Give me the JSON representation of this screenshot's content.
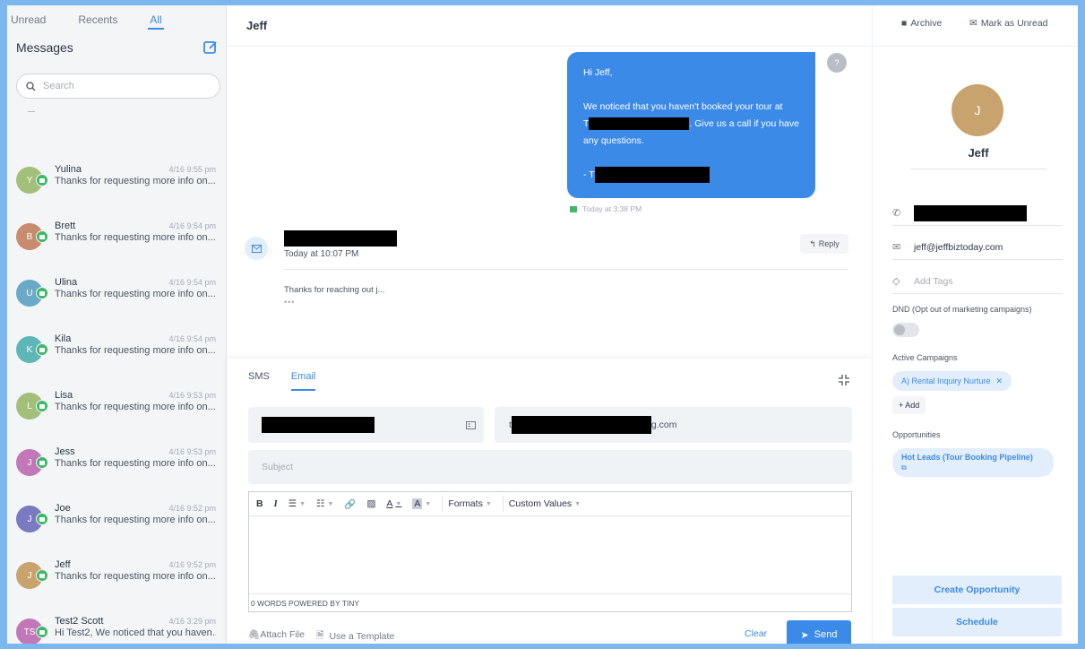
{
  "sidebar": {
    "tabs": [
      {
        "label": "Unread"
      },
      {
        "label": "Recents"
      },
      {
        "label": "All"
      }
    ],
    "title": "Messages",
    "search_placeholder": "Search",
    "conversations": [
      {
        "initial": "Y",
        "name": "Yulina",
        "time": "4/16 9:55 pm",
        "preview": "Thanks for requesting more info on...",
        "color": "#a3c07a"
      },
      {
        "initial": "B",
        "name": "Brett",
        "time": "4/16 9:54 pm",
        "preview": "Thanks for requesting more info on...",
        "color": "#c88b6e"
      },
      {
        "initial": "U",
        "name": "Ulina",
        "time": "4/16 9:54 pm",
        "preview": "Thanks for requesting more info on...",
        "color": "#6aa9c7"
      },
      {
        "initial": "K",
        "name": "Kila",
        "time": "4/16 9:54 pm",
        "preview": "Thanks for requesting more info on...",
        "color": "#5fb6b9"
      },
      {
        "initial": "L",
        "name": "Lisa",
        "time": "4/16 9:53 pm",
        "preview": "Thanks for requesting more info on...",
        "color": "#a3c07a"
      },
      {
        "initial": "J",
        "name": "Jess",
        "time": "4/16 9:53 pm",
        "preview": "Thanks for requesting more info on...",
        "color": "#c278b6"
      },
      {
        "initial": "J",
        "name": "Joe",
        "time": "4/16 9:52 pm",
        "preview": "Thanks for requesting more info on...",
        "color": "#7b79c0"
      },
      {
        "initial": "J",
        "name": "Jeff",
        "time": "4/16 9:52 pm",
        "preview": "Thanks for requesting more info on...",
        "color": "#c9a36e"
      },
      {
        "initial": "TS",
        "name": "Test2 Scott",
        "time": "4/16 3:29 pm",
        "preview": "Hi Test2, We noticed that you haven...",
        "color": "#c278b6"
      }
    ]
  },
  "main": {
    "contact_name": "Jeff",
    "bubble": {
      "greeting": "Hi Jeff,",
      "line1": "We noticed that you haven't booked your tour at",
      "line2_prefix": "T",
      "line2_suffix": ". Give us a call if you have",
      "line3": "any questions.",
      "sign_prefix": "- T",
      "time": "Today at 3:38 PM",
      "avatar": "?"
    },
    "email": {
      "time": "Today at 10:07 PM",
      "reply_label": "Reply",
      "snippet": "Thanks for reaching out j...",
      "dots": "•••"
    },
    "composer": {
      "tabs": [
        "SMS",
        "Email"
      ],
      "to_suffix": "g.com",
      "subject_placeholder": "Subject",
      "toolbar": {
        "bold": "B",
        "italic": "I",
        "font_color": "A",
        "bg_color": "A",
        "formats": "Formats",
        "custom_values": "Custom Values"
      },
      "footer": "0 WORDS POWERED BY TINY",
      "attach_label": "Attach File",
      "template_label": "Use a Template",
      "clear_label": "Clear",
      "send_label": "Send"
    }
  },
  "right": {
    "archive_label": "Archive",
    "mark_unread_label": "Mark as Unread",
    "avatar_initial": "J",
    "name": "Jeff",
    "email": "jeff@jeffbiztoday.com",
    "tags_placeholder": "Add Tags",
    "dnd_label": "DND (Opt out of marketing campaigns)",
    "campaigns_label": "Active Campaigns",
    "campaign": "A) Rental Inquiry Nurture",
    "add_label": "+ Add",
    "opportunities_label": "Opportunities",
    "opportunity": "Hot Leads (Tour Booking Pipeline)",
    "create_opportunity": "Create Opportunity",
    "schedule": "Schedule"
  },
  "colors": {
    "accent": "#3c8ae8",
    "sms_green": "#3fb86a",
    "background_frame": "#7db7ef"
  }
}
